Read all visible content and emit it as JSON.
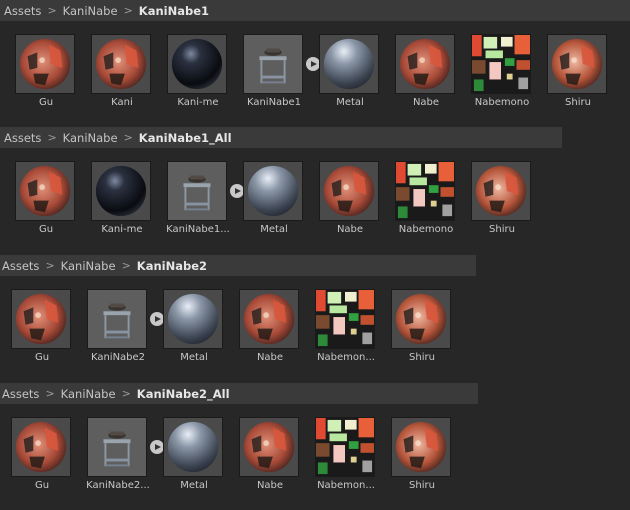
{
  "sections": [
    {
      "breadcrumb": [
        "Assets",
        "KaniNabe",
        "KaniNabe1"
      ],
      "items": [
        {
          "label": "Gu",
          "kind": "sphere-red"
        },
        {
          "label": "Kani",
          "kind": "sphere-red"
        },
        {
          "label": "Kani-me",
          "kind": "sphere-dark"
        },
        {
          "label": "KaniNabe1",
          "kind": "model"
        },
        {
          "label": "Metal",
          "kind": "sphere-metal"
        },
        {
          "label": "Nabe",
          "kind": "sphere-red"
        },
        {
          "label": "Nabemono",
          "kind": "texture"
        },
        {
          "label": "Shiru",
          "kind": "sphere-warm"
        }
      ]
    },
    {
      "breadcrumb": [
        "Assets",
        "KaniNabe",
        "KaniNabe1_All"
      ],
      "items": [
        {
          "label": "Gu",
          "kind": "sphere-red"
        },
        {
          "label": "Kani-me",
          "kind": "sphere-dark"
        },
        {
          "label": "KaniNabe1...",
          "kind": "model"
        },
        {
          "label": "Metal",
          "kind": "sphere-metal"
        },
        {
          "label": "Nabe",
          "kind": "sphere-red"
        },
        {
          "label": "Nabemono",
          "kind": "texture"
        },
        {
          "label": "Shiru",
          "kind": "sphere-warm"
        }
      ]
    },
    {
      "breadcrumb": [
        "Assets",
        "KaniNabe",
        "KaniNabe2"
      ],
      "items": [
        {
          "label": "Gu",
          "kind": "sphere-red"
        },
        {
          "label": "KaniNabe2",
          "kind": "model"
        },
        {
          "label": "Metal",
          "kind": "sphere-metal"
        },
        {
          "label": "Nabe",
          "kind": "sphere-red"
        },
        {
          "label": "Nabemon...",
          "kind": "texture"
        },
        {
          "label": "Shiru",
          "kind": "sphere-warm"
        }
      ]
    },
    {
      "breadcrumb": [
        "Assets",
        "KaniNabe",
        "KaniNabe2_All"
      ],
      "items": [
        {
          "label": "Gu",
          "kind": "sphere-red"
        },
        {
          "label": "KaniNabe2...",
          "kind": "model"
        },
        {
          "label": "Metal",
          "kind": "sphere-metal"
        },
        {
          "label": "Nabe",
          "kind": "sphere-red"
        },
        {
          "label": "Nabemon...",
          "kind": "texture"
        },
        {
          "label": "Shiru",
          "kind": "sphere-warm"
        }
      ]
    }
  ],
  "colors": {
    "background": "#272727",
    "breadcrumb_bar": "#3a3a3a",
    "thumb_bg": "#4a4a4a",
    "label": "#c8c8c8"
  }
}
